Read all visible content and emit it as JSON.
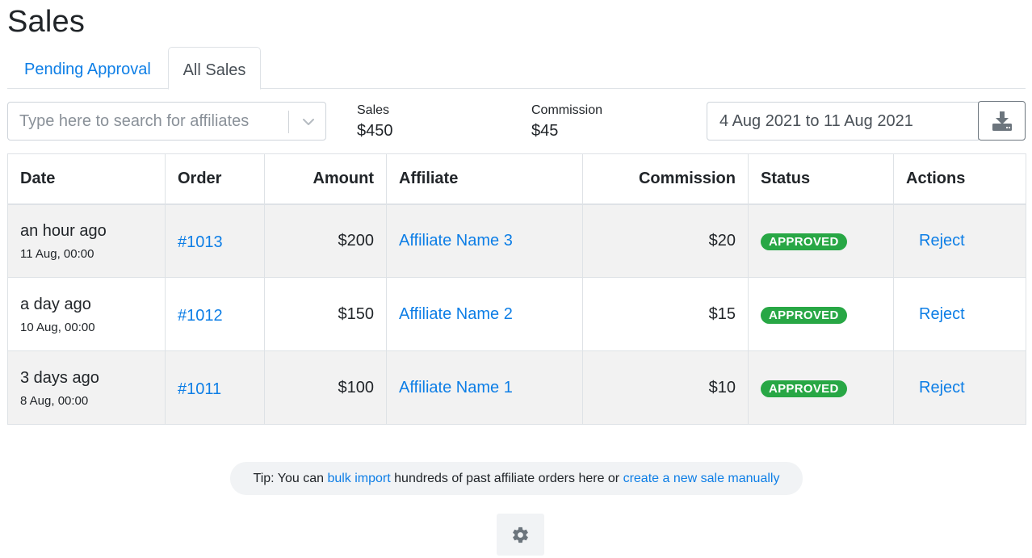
{
  "page": {
    "title": "Sales"
  },
  "tabs": [
    {
      "label": "Pending Approval",
      "active": false
    },
    {
      "label": "All Sales",
      "active": true
    }
  ],
  "search": {
    "placeholder": "Type here to search for affiliates",
    "value": ""
  },
  "stats": {
    "sales": {
      "label": "Sales",
      "value": "$450"
    },
    "commission": {
      "label": "Commission",
      "value": "$45"
    }
  },
  "date_range": {
    "value": "4 Aug 2021 to 11 Aug 2021"
  },
  "table": {
    "headers": {
      "date": "Date",
      "order": "Order",
      "amount": "Amount",
      "affiliate": "Affiliate",
      "commission": "Commission",
      "status": "Status",
      "actions": "Actions"
    },
    "rows": [
      {
        "date_relative": "an hour ago",
        "date_absolute": "11 Aug, 00:00",
        "order": "#1013",
        "amount": "$200",
        "affiliate": "Affiliate Name 3",
        "commission": "$20",
        "status": "APPROVED",
        "action": "Reject"
      },
      {
        "date_relative": "a day ago",
        "date_absolute": "10 Aug, 00:00",
        "order": "#1012",
        "amount": "$150",
        "affiliate": "Affiliate Name 2",
        "commission": "$15",
        "status": "APPROVED",
        "action": "Reject"
      },
      {
        "date_relative": "3 days ago",
        "date_absolute": "8 Aug, 00:00",
        "order": "#1011",
        "amount": "$100",
        "affiliate": "Affiliate Name 1",
        "commission": "$10",
        "status": "APPROVED",
        "action": "Reject"
      }
    ]
  },
  "tip": {
    "prefix": "Tip: You can ",
    "bulk_import_link": "bulk import",
    "middle": " hundreds of past affiliate orders here or ",
    "create_link": "create a new sale manually"
  },
  "icons": {
    "search_dropdown": "chevron-down-icon",
    "download": "download-icon",
    "settings": "gear-icon"
  },
  "colors": {
    "link": "#0d7ee6",
    "approved_badge": "#28a745",
    "striped_row": "#f2f2f2"
  }
}
